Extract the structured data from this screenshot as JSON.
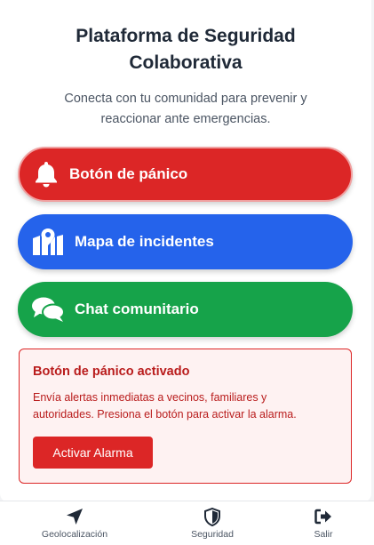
{
  "header": {
    "title_line1": "Plataforma de Seguridad",
    "title_line2": "Colaborativa",
    "subtitle_line1": "Conecta con tu comunidad para prevenir y",
    "subtitle_line2": "reaccionar ante emergencias."
  },
  "actions": {
    "panic": {
      "label": "Botón de pánico",
      "icon": "bell-icon",
      "color": "#dc2626"
    },
    "map": {
      "label": "Mapa de incidentes",
      "icon": "map-marker-icon",
      "color": "#2563eb"
    },
    "chat": {
      "label": "Chat comunitario",
      "icon": "chat-bubbles-icon",
      "color": "#16a34a"
    }
  },
  "alert": {
    "title": "Botón de pánico activado",
    "text_line1": "Envía alertas inmediatas a vecinos, familiares y",
    "text_line2": "autoridades. Presiona el botón para activar la alarma.",
    "button_label": "Activar Alarma",
    "color": "#b91c1c",
    "background": "#fef2f2"
  },
  "bottom_nav": {
    "items": [
      {
        "label": "Geolocalización",
        "icon": "location-arrow-icon"
      },
      {
        "label": "Seguridad",
        "icon": "shield-icon"
      },
      {
        "label": "Salir",
        "icon": "sign-out-icon"
      }
    ]
  }
}
